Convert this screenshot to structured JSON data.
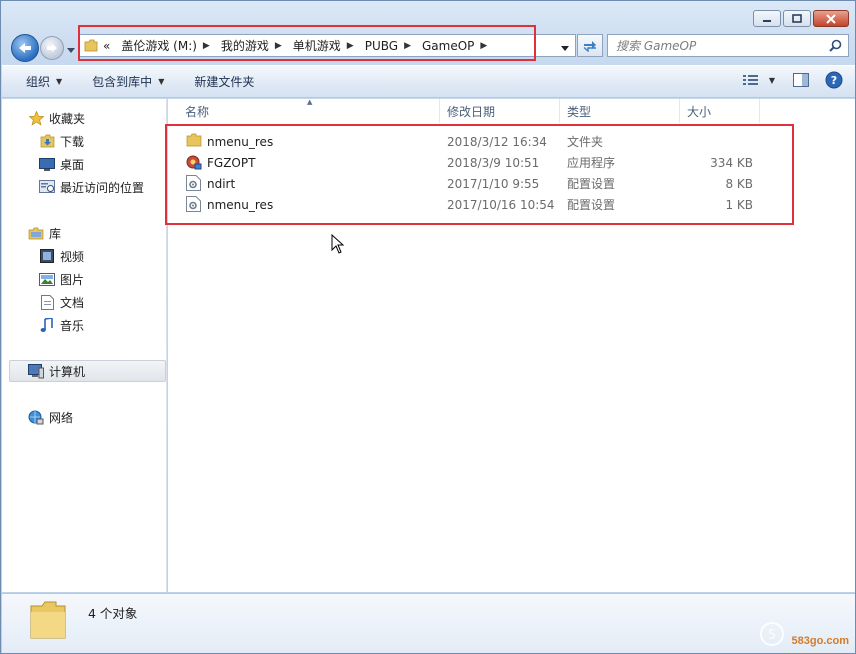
{
  "window": {
    "caption_buttons": [
      "minimize",
      "maximize",
      "close"
    ]
  },
  "address": {
    "prefix": "«",
    "crumbs": [
      "盖伦游戏 (M:)",
      "我的游戏",
      "单机游戏",
      "PUBG",
      "GameOP"
    ]
  },
  "search": {
    "placeholder": "搜索 GameOP"
  },
  "toolbar": {
    "organize": "组织",
    "include_in_library": "包含到库中",
    "new_folder": "新建文件夹"
  },
  "nav": {
    "favorites": {
      "label": "收藏夹",
      "items": [
        "下载",
        "桌面",
        "最近访问的位置"
      ]
    },
    "libraries": {
      "label": "库",
      "items": [
        "视频",
        "图片",
        "文档",
        "音乐"
      ]
    },
    "computer": "计算机",
    "network": "网络"
  },
  "columns": {
    "name": "名称",
    "modified": "修改日期",
    "type": "类型",
    "size": "大小"
  },
  "files": [
    {
      "name": "nmenu_res",
      "modified": "2018/3/12 16:34",
      "type": "文件夹",
      "size": "",
      "icon": "folder-icon"
    },
    {
      "name": "FGZOPT",
      "modified": "2018/3/9 10:51",
      "type": "应用程序",
      "size": "334 KB",
      "icon": "application-icon"
    },
    {
      "name": "ndirt",
      "modified": "2017/1/10 9:55",
      "type": "配置设置",
      "size": "8 KB",
      "icon": "config-file-icon"
    },
    {
      "name": "nmenu_res",
      "modified": "2017/10/16 10:54",
      "type": "配置设置",
      "size": "1 KB",
      "icon": "config-file-icon"
    }
  ],
  "details": {
    "count_text": "4 个对象"
  },
  "watermark": {
    "brand": "583go.com"
  },
  "colors": {
    "highlight_box": "#e0313a",
    "window_frame": "#c7d9ee",
    "folder": "#e8c55a"
  }
}
